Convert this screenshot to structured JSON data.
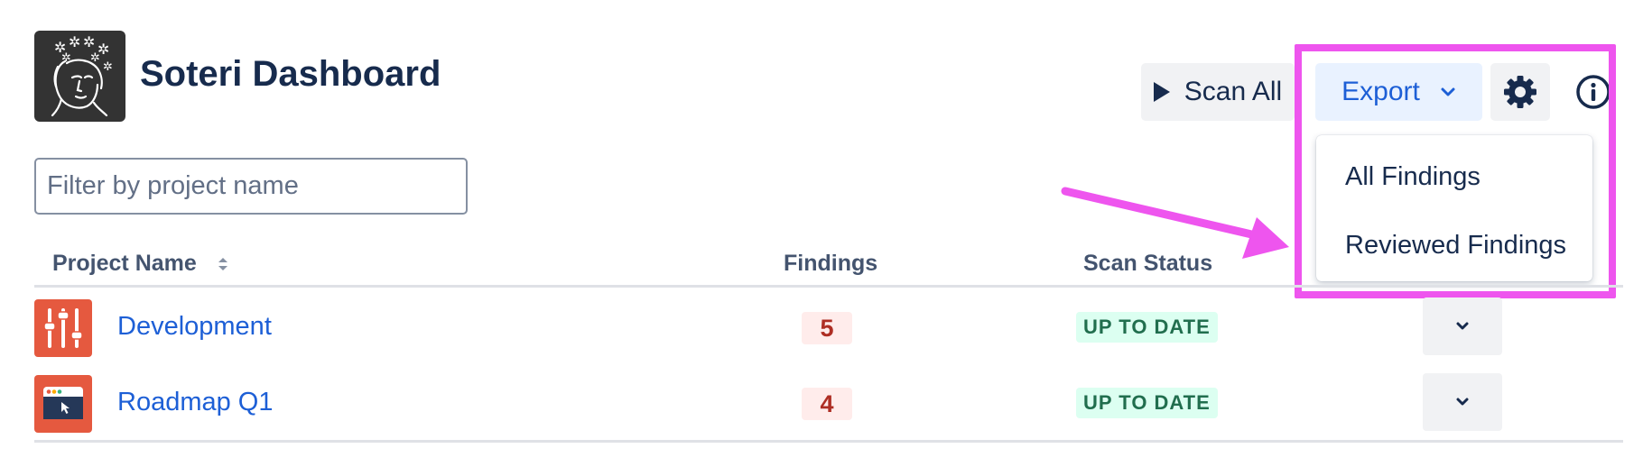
{
  "header": {
    "title": "Soteri Dashboard",
    "logo_icon": "soteri-face-logo"
  },
  "toolbar": {
    "scan_all_label": "Scan All",
    "scan_icon": "play-icon",
    "export_label": "Export",
    "export_icon": "chevron-down-icon",
    "settings_icon": "gear-icon",
    "info_icon": "info-icon"
  },
  "export_menu": {
    "items": [
      {
        "label": "All Findings"
      },
      {
        "label": "Reviewed Findings"
      }
    ]
  },
  "filter": {
    "placeholder": "Filter by project name",
    "value": ""
  },
  "table": {
    "columns": {
      "name": "Project Name",
      "findings": "Findings",
      "status": "Scan Status"
    },
    "rows": [
      {
        "name": "Development",
        "findings": "5",
        "status": "UP TO DATE",
        "icon": "sliders-icon"
      },
      {
        "name": "Roadmap Q1",
        "findings": "4",
        "status": "UP TO DATE",
        "icon": "browser-window-icon"
      }
    ]
  },
  "colors": {
    "accent": "#1d5fd6",
    "highlight": "#ee55ee",
    "project_icon_bg": "#e5593f",
    "findings_badge_bg": "#ffeceb",
    "findings_badge_text": "#ae2e24",
    "status_badge_bg": "#dcfff1",
    "status_badge_text": "#216e4e"
  }
}
